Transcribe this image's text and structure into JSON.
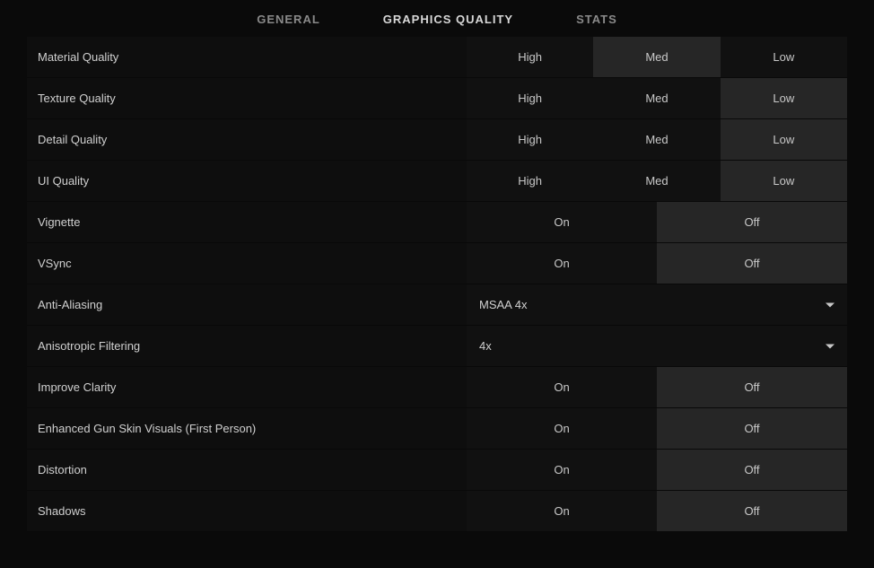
{
  "tabs": {
    "general": "GENERAL",
    "graphics": "GRAPHICS QUALITY",
    "stats": "STATS",
    "active": "graphics"
  },
  "labels": {
    "material_quality": "Material Quality",
    "texture_quality": "Texture Quality",
    "detail_quality": "Detail Quality",
    "ui_quality": "UI Quality",
    "vignette": "Vignette",
    "vsync": "VSync",
    "anti_aliasing": "Anti-Aliasing",
    "anisotropic_filtering": "Anisotropic Filtering",
    "improve_clarity": "Improve Clarity",
    "enhanced_gun_skin": "Enhanced Gun Skin Visuals (First Person)",
    "distortion": "Distortion",
    "shadows": "Shadows"
  },
  "options": {
    "high": "High",
    "med": "Med",
    "low": "Low",
    "on": "On",
    "off": "Off"
  },
  "values": {
    "material_quality": "Med",
    "texture_quality": "Low",
    "detail_quality": "Low",
    "ui_quality": "Low",
    "vignette": "Off",
    "vsync": "Off",
    "anti_aliasing": "MSAA 4x",
    "anisotropic_filtering": "4x",
    "improve_clarity": "Off",
    "enhanced_gun_skin": "Off",
    "distortion": "Off",
    "shadows": "Off"
  }
}
